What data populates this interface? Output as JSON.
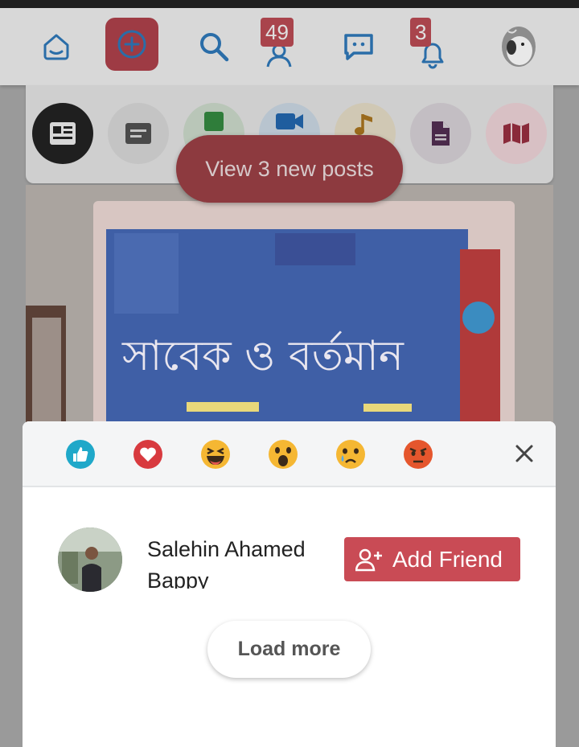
{
  "nav": {
    "items": [
      {
        "name": "home-icon"
      },
      {
        "name": "add-post-icon"
      },
      {
        "name": "search-icon"
      },
      {
        "name": "friend-requests-icon",
        "badge": "49"
      },
      {
        "name": "messages-icon"
      },
      {
        "name": "notifications-icon",
        "badge": "3"
      },
      {
        "name": "profile-avatar"
      }
    ],
    "friend_badge": "49",
    "notif_badge": "3"
  },
  "filters": [
    "news-feed-icon",
    "text-icon",
    "image-icon",
    "video-icon",
    "audio-icon",
    "document-icon",
    "map-icon"
  ],
  "banner": {
    "new_posts": "View 3 new posts"
  },
  "reactions": [
    "like",
    "love",
    "haha",
    "wow",
    "sad",
    "angry"
  ],
  "user": {
    "name": "Salehin Ahamed Bappy",
    "add_friend": "Add Friend"
  },
  "load_more": "Load more",
  "colors": {
    "accent": "#c94b55",
    "like": "#1fa8c9",
    "love": "#d83a3f",
    "emoji": "#f5b733",
    "angry": "#e5562d"
  }
}
